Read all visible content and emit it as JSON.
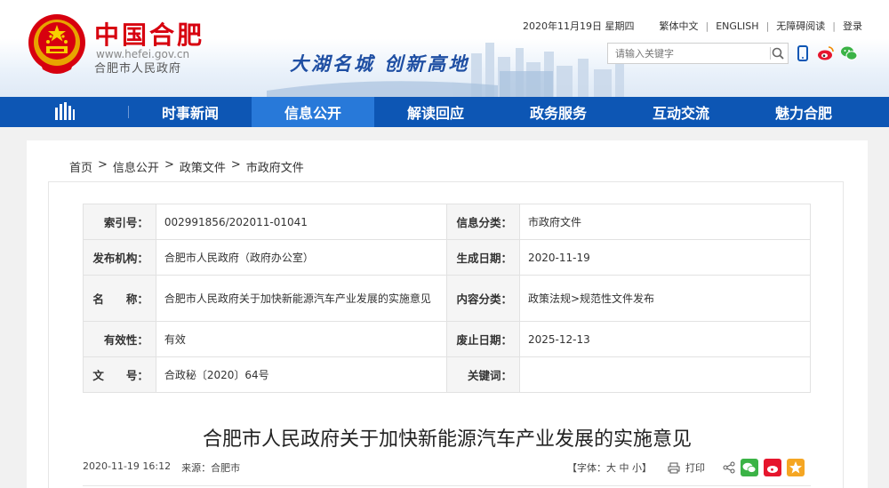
{
  "header": {
    "brand_name": "中国合肥",
    "brand_url": "www.hefei.gov.cn",
    "brand_sub": "合肥市人民政府",
    "slogan": "大湖名城  创新高地",
    "date": "2020年11月19日 星期四",
    "links": [
      "繁体中文",
      "ENGLISH",
      "无障碍阅读",
      "登录"
    ],
    "search_placeholder": "请输入关键字"
  },
  "nav": {
    "items": [
      {
        "label": "时事新闻",
        "active": false
      },
      {
        "label": "信息公开",
        "active": true
      },
      {
        "label": "解读回应",
        "active": false
      },
      {
        "label": "政务服务",
        "active": false
      },
      {
        "label": "互动交流",
        "active": false
      },
      {
        "label": "魅力合肥",
        "active": false
      }
    ]
  },
  "breadcrumb": [
    "首页",
    ">",
    "信息公开",
    ">",
    "政策文件",
    ">",
    "市政府文件"
  ],
  "info": {
    "index_label": "索引号：",
    "index_value": "002991856/202011-01041",
    "category_label": "信息分类：",
    "category_value": "市政府文件",
    "publisher_label": "发布机构：",
    "publisher_value": "合肥市人民政府（政府办公室）",
    "created_label": "生成日期：",
    "created_value": "2020-11-19",
    "name_label": "名　　称：",
    "name_value": "合肥市人民政府关于加快新能源汽车产业发展的实施意见",
    "content_label": "内容分类：",
    "content_value": "政策法规>规范性文件发布",
    "validity_label": "有效性：",
    "validity_value": "有效",
    "expire_label": "废止日期：",
    "expire_value": "2025-12-13",
    "docno_label": "文　　号：",
    "docno_value": "合政秘〔2020〕64号",
    "keywords_label": "关键词：",
    "keywords_value": ""
  },
  "article": {
    "title": "合肥市人民政府关于加快新能源汽车产业发展的实施意见",
    "datetime": "2020-11-19 16:12",
    "source": "来源：合肥市",
    "font_label": "【字体：大  中  小】",
    "print_label": "打印"
  },
  "colors": {
    "nav_bg": "#0d56b4",
    "nav_active": "#2879d9",
    "brand_red": "#d7000f"
  }
}
